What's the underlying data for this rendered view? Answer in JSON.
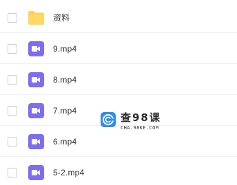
{
  "files": [
    {
      "name": "资料",
      "type": "folder",
      "icon": "folder-icon"
    },
    {
      "name": "9.mp4",
      "type": "video",
      "icon": "video-icon"
    },
    {
      "name": "8.mp4",
      "type": "video",
      "icon": "video-icon"
    },
    {
      "name": "7.mp4",
      "type": "video",
      "icon": "video-icon"
    },
    {
      "name": "6.mp4",
      "type": "video",
      "icon": "video-icon"
    },
    {
      "name": "5-2.mp4",
      "type": "video",
      "icon": "video-icon"
    }
  ],
  "watermark": {
    "title": "查98课",
    "url": "CHA.98KE.COM"
  },
  "colors": {
    "folder": "#FDD35A",
    "video": "#7B6FF0",
    "checkbox_border": "#C9CDD4",
    "text": "#333333",
    "watermark_logo": "#2F8FE6"
  }
}
